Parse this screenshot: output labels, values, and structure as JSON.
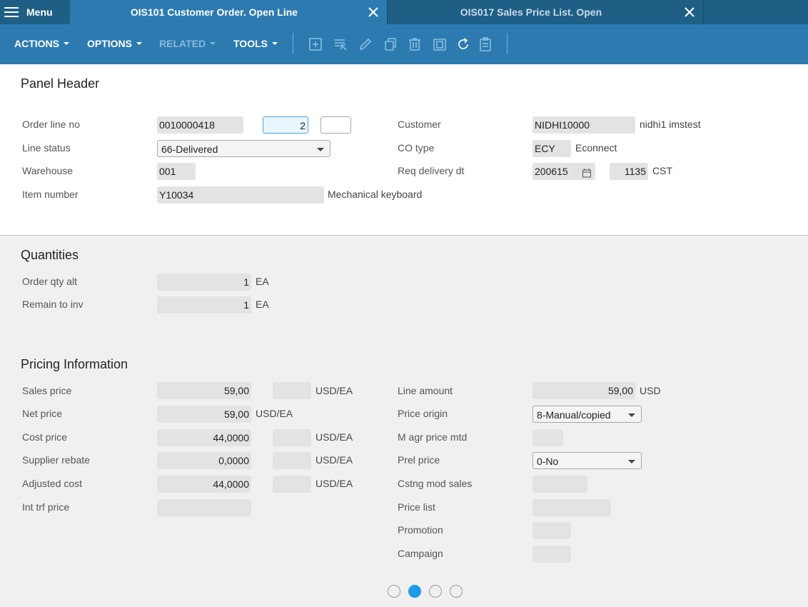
{
  "tabs": {
    "menu_label": "Menu",
    "active": {
      "label": "OIS101 Customer Order. Open Line"
    },
    "inactive": {
      "label": "OIS017 Sales Price List. Open"
    }
  },
  "toolbar": {
    "actions": "ACTIONS",
    "options": "OPTIONS",
    "related": "RELATED",
    "tools": "TOOLS"
  },
  "header": {
    "title": "Panel Header",
    "order_line_no": {
      "label": "Order line no",
      "value": "0010000418",
      "subline": "2",
      "subline2": ""
    },
    "line_status": {
      "label": "Line status",
      "value": "66-Delivered"
    },
    "warehouse": {
      "label": "Warehouse",
      "value": "001"
    },
    "item_number": {
      "label": "Item number",
      "value": "Y10034",
      "desc": "Mechanical keyboard"
    },
    "customer": {
      "label": "Customer",
      "value": "NIDHI10000",
      "desc": "nidhi1 imstest"
    },
    "co_type": {
      "label": "CO type",
      "value": "ECY",
      "desc": "Econnect"
    },
    "req_delivery": {
      "label": "Req delivery dt",
      "date": "200615",
      "time": "1135",
      "tz": "CST"
    }
  },
  "quantities": {
    "title": "Quantities",
    "order_qty_alt": {
      "label": "Order qty alt",
      "value": "1",
      "unit": "EA"
    },
    "remain_to_inv": {
      "label": "Remain to inv",
      "value": "1",
      "unit": "EA"
    }
  },
  "pricing": {
    "title": "Pricing Information",
    "sales_price": {
      "label": "Sales price",
      "value": "59,00",
      "unit": "USD/EA"
    },
    "net_price": {
      "label": "Net price",
      "value": "59,00",
      "unit": "USD/EA"
    },
    "cost_price": {
      "label": "Cost price",
      "value": "44,0000",
      "unit": "USD/EA"
    },
    "supplier_rebate": {
      "label": "Supplier rebate",
      "value": "0,0000",
      "unit": "USD/EA"
    },
    "adjusted_cost": {
      "label": "Adjusted cost",
      "value": "44,0000",
      "unit": "USD/EA"
    },
    "int_trf_price": {
      "label": "Int trf price",
      "value": ""
    },
    "line_amount": {
      "label": "Line amount",
      "value": "59,00",
      "unit": "USD"
    },
    "price_origin": {
      "label": "Price origin",
      "value": "8-Manual/copied"
    },
    "m_agr_price_mtd": {
      "label": "M agr price mtd",
      "value": ""
    },
    "prel_price": {
      "label": "Prel price",
      "value": "0-No"
    },
    "cstng_mod_sales": {
      "label": "Cstng mod sales",
      "value": ""
    },
    "price_list": {
      "label": "Price list",
      "value": ""
    },
    "promotion": {
      "label": "Promotion",
      "value": ""
    },
    "campaign": {
      "label": "Campaign",
      "value": ""
    }
  },
  "pager": {
    "pages": 4,
    "active_page": 2
  },
  "colors": {
    "tabbar": "#1f5f86",
    "toolbar": "#2c7ab0",
    "accent": "#1e9be8"
  }
}
